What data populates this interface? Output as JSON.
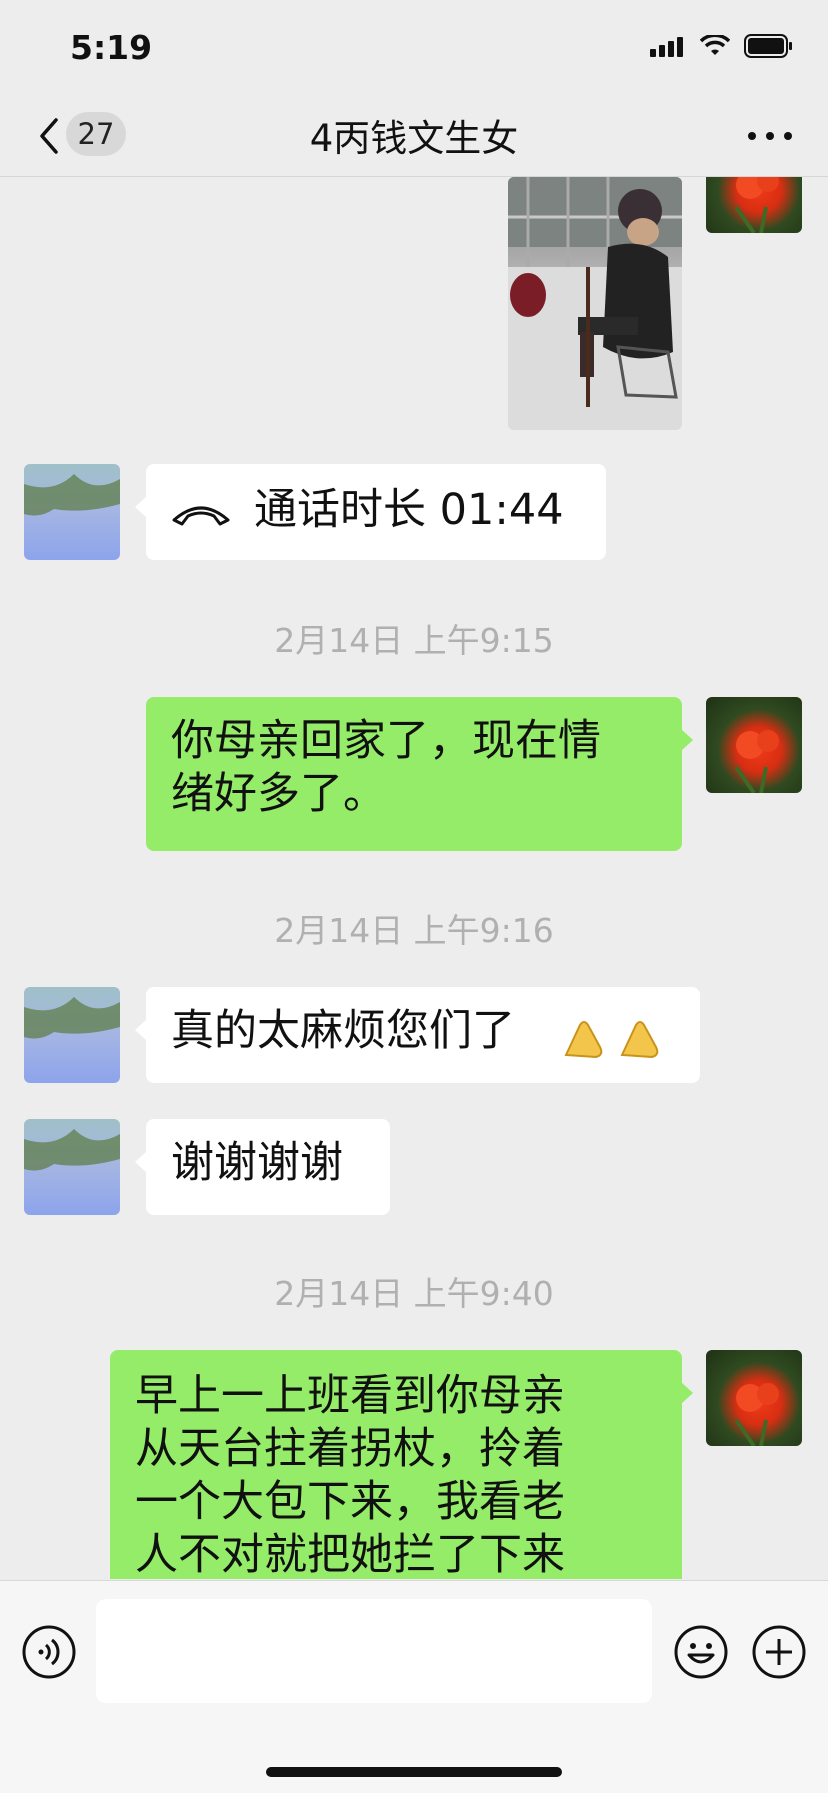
{
  "status_bar": {
    "time": "5:19"
  },
  "nav": {
    "unread_count": "27",
    "title": "4丙钱文生女"
  },
  "messages": {
    "call": {
      "label": "通话时长 01:44"
    },
    "ts1": "2月14日 上午9:15",
    "msg1": {
      "line1": "你母亲回家了，现在情",
      "line2": "绪好多了。"
    },
    "ts2": "2月14日 上午9:16",
    "msg2": {
      "text": "真的太麻烦您们了"
    },
    "msg3": {
      "text": "谢谢谢谢"
    },
    "ts3": "2月14日 上午9:40",
    "msg4": {
      "line1": "早上一上班看到你母亲",
      "line2": "从天台拄着拐杖，拎着",
      "line3": "一个大包下来，我看老",
      "line4": "人不对就把她拦了下来"
    }
  },
  "icons": [
    "back-icon",
    "more-icon",
    "call-icon",
    "wave-hands-emoji",
    "voice-icon",
    "emoji-icon",
    "plus-icon"
  ],
  "colors": {
    "my_bubble": "#95ec69",
    "friend_bubble": "#ffffff",
    "background": "#ededed"
  }
}
